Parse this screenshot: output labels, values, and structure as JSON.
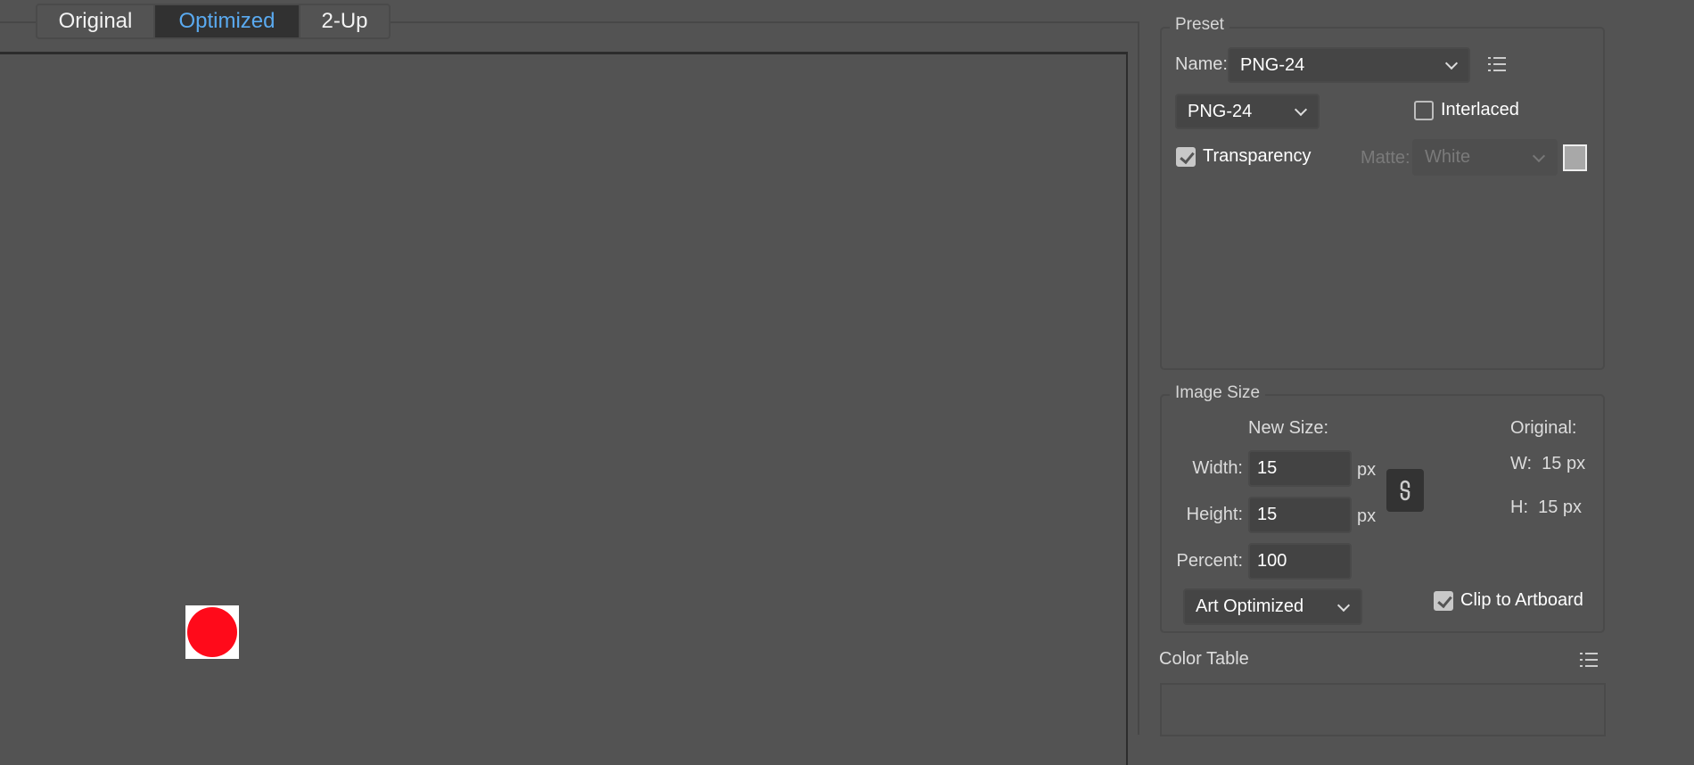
{
  "tabs": [
    {
      "label": "Original"
    },
    {
      "label": "Optimized",
      "selected": true
    },
    {
      "label": "2-Up"
    }
  ],
  "preview": {
    "shape_color": "#ff0a1a"
  },
  "preset": {
    "title": "Preset",
    "name_label": "Name:",
    "name_value": "PNG-24",
    "format_value": "PNG-24",
    "interlaced_label": "Interlaced",
    "interlaced": false,
    "transparency_label": "Transparency",
    "transparency": true,
    "matte_label": "Matte:",
    "matte_value": "White",
    "matte_swatch": "#a8a8a8"
  },
  "image_size": {
    "title": "Image Size",
    "new_size_label": "New Size:",
    "width_label": "Width:",
    "width_value": "15",
    "width_unit": "px",
    "height_label": "Height:",
    "height_value": "15",
    "height_unit": "px",
    "percent_label": "Percent:",
    "percent_value": "100",
    "original_label": "Original:",
    "original_w": "W:  15 px",
    "original_h": "H:  15 px",
    "resample_value": "Art Optimized",
    "clip_label": "Clip to Artboard",
    "clip": true
  },
  "color_table": {
    "title": "Color Table"
  },
  "colors": {
    "accent": "#5aaaf0",
    "background": "#535353"
  }
}
